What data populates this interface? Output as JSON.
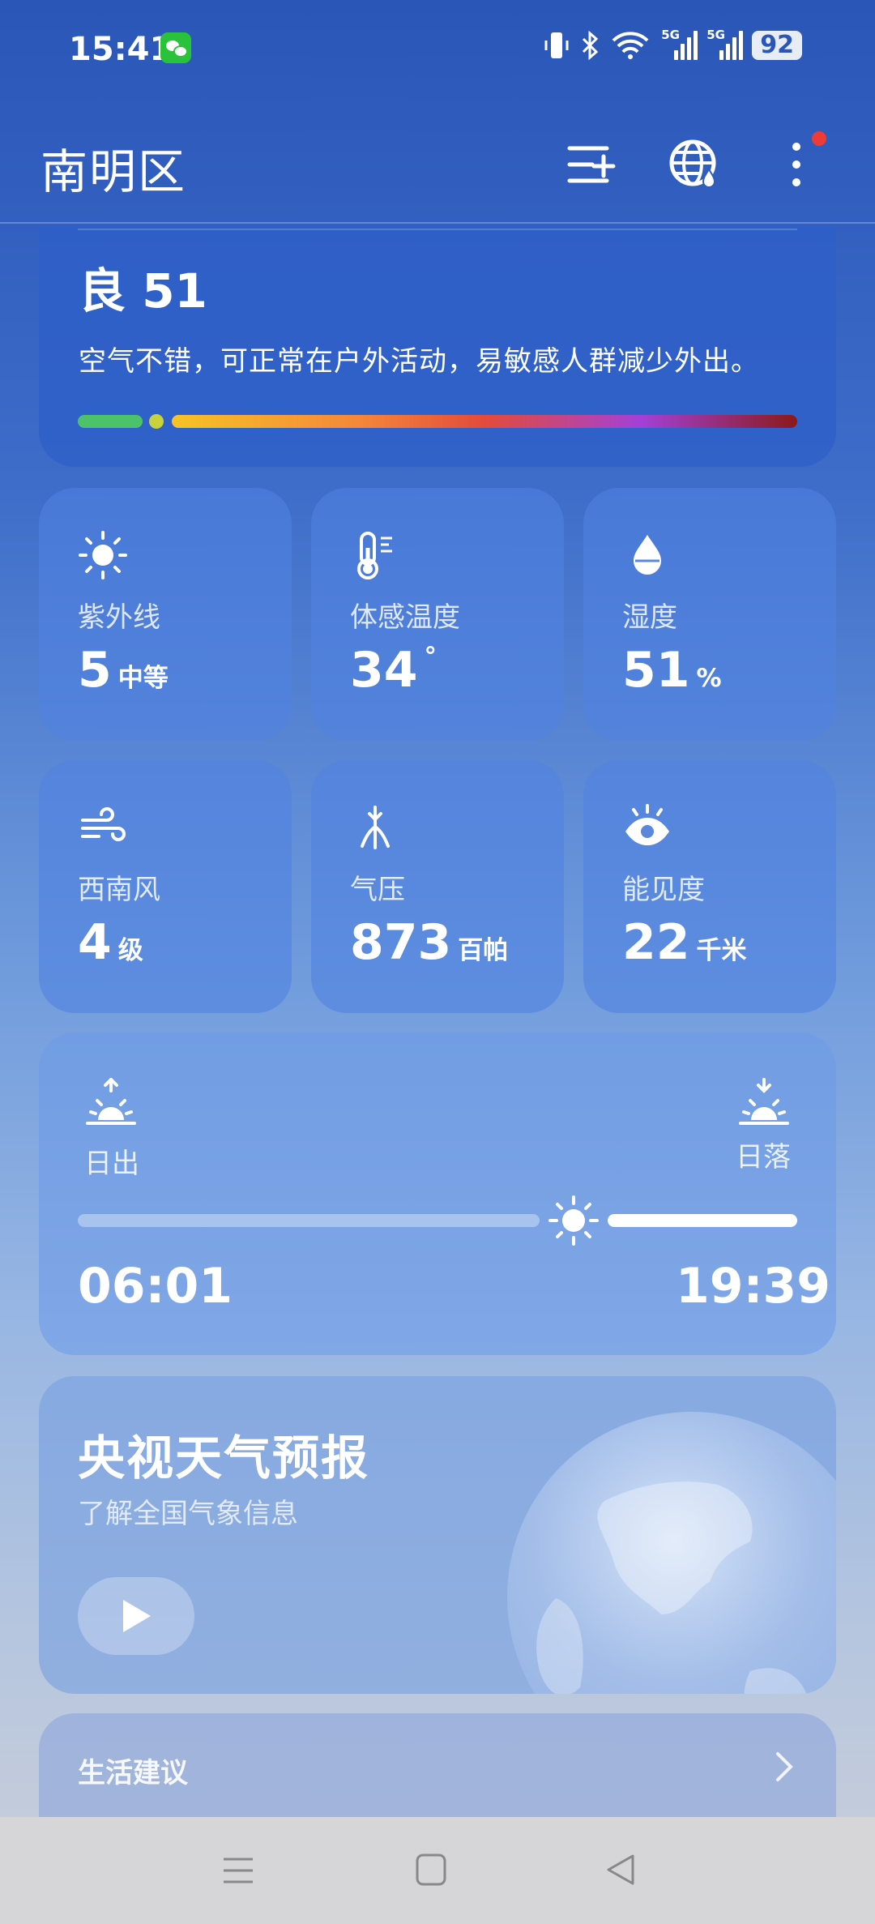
{
  "status_bar": {
    "time": "15:41",
    "battery": "92",
    "signal_label_1": "5G",
    "signal_label_2": "5G"
  },
  "header": {
    "title": "南明区"
  },
  "aqi": {
    "value": "良 51",
    "description": "空气不错，可正常在户外活动，易敏感人群减少外出。"
  },
  "tiles": [
    {
      "label": "紫外线",
      "value": "5",
      "unit": "中等",
      "icon": "sun-icon"
    },
    {
      "label": "体感温度",
      "value": "34",
      "unit": "°",
      "icon": "thermometer-icon"
    },
    {
      "label": "湿度",
      "value": "51",
      "unit": "%",
      "icon": "droplet-icon"
    },
    {
      "label": "西南风",
      "value": "4",
      "unit": "级",
      "icon": "wind-icon"
    },
    {
      "label": "气压",
      "value": "873",
      "unit": "百帕",
      "icon": "pressure-icon"
    },
    {
      "label": "能见度",
      "value": "22",
      "unit": "千米",
      "icon": "eye-icon"
    }
  ],
  "sun": {
    "sunrise_label": "日出",
    "sunset_label": "日落",
    "sunrise_time": "06:01",
    "sunset_time": "19:39"
  },
  "cctv": {
    "title": "央视天气预报",
    "subtitle": "了解全国气象信息"
  },
  "life": {
    "title": "生活建议"
  },
  "colors": {
    "aqi_good": "#4cc36a",
    "aqi_moderate": "#c8d23c",
    "aqi_gradient_start": "#f7c325",
    "aqi_gradient_end": "#8a1a1a"
  }
}
